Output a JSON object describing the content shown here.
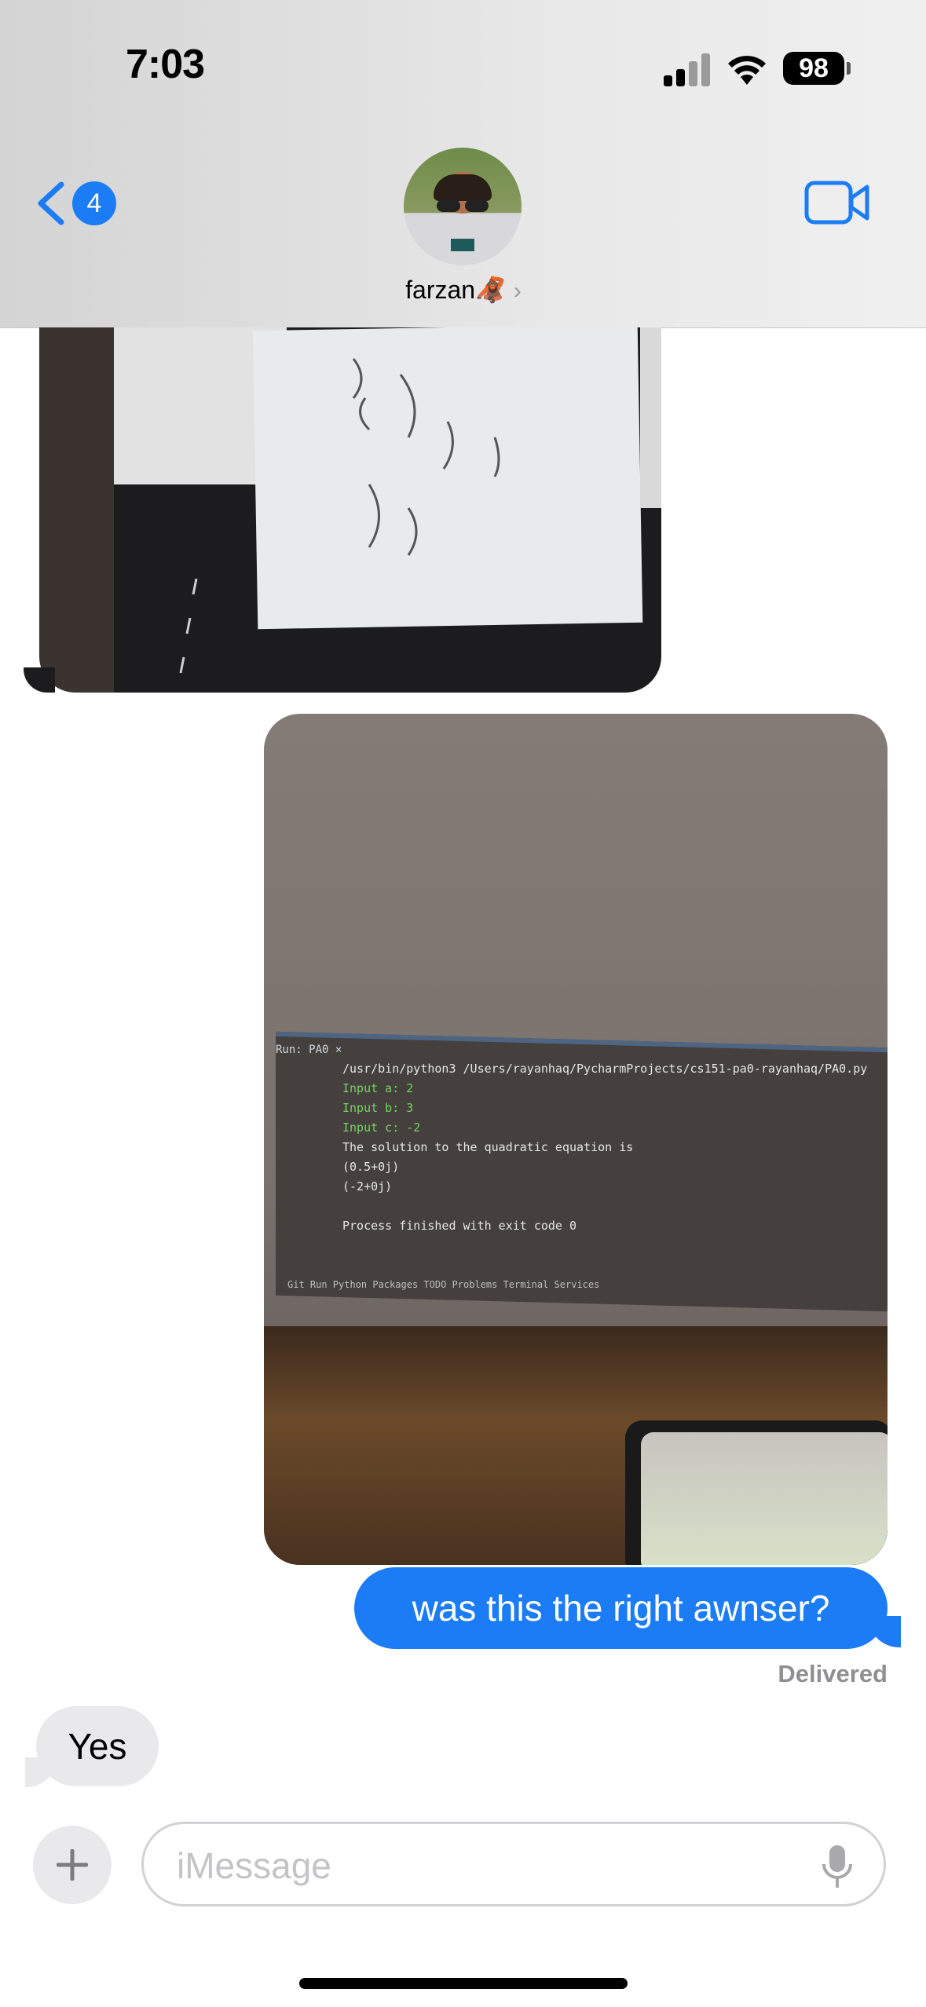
{
  "status_bar": {
    "time": "7:03",
    "battery": "98"
  },
  "header": {
    "back_badge": "4",
    "contact_name": "farzan🦧",
    "icons": {
      "back": "chevron-left-icon",
      "video": "video-camera-icon",
      "disclosure": "chevron-right-icon"
    }
  },
  "colors": {
    "accent": "#1b7cf5",
    "incoming_bubble": "#e9e9eb",
    "muted_text": "#8e8e93"
  },
  "messages": {
    "outgoing_text": "was this the right awnser?",
    "delivered_label": "Delivered",
    "incoming_text": "Yes"
  },
  "photo_sent": {
    "tab": "Run:  PA0 ×",
    "lines": [
      "/usr/bin/python3 /Users/rayanhaq/PycharmProjects/cs151-pa0-rayanhaq/PA0.py",
      "Input a: 2",
      "Input b: 3",
      "Input c: -2",
      "The solution to the quadratic equation is",
      "(0.5+0j)",
      "(-2+0j)",
      "",
      "Process finished with exit code 0"
    ],
    "bottom_tabs": "Git   Run   Python Packages   TODO   Problems   Terminal   Services"
  },
  "composer": {
    "placeholder": "iMessage"
  }
}
